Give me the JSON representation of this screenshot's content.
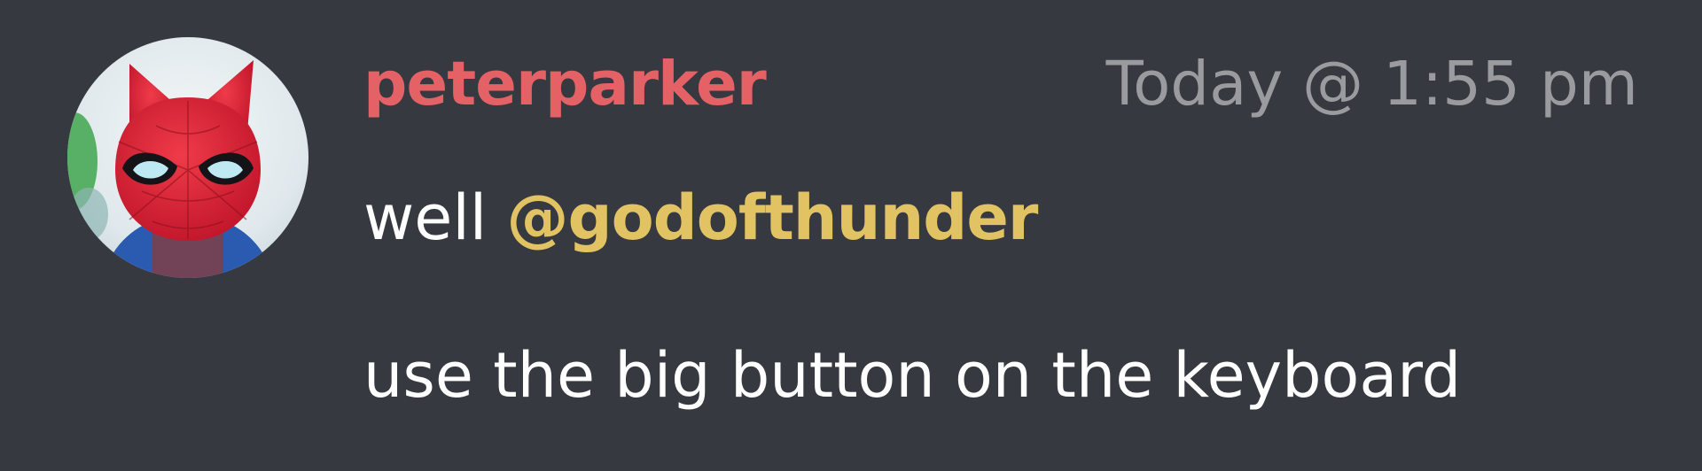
{
  "message": {
    "author": "peterparker",
    "timestamp": "Today @ 1:55 pm",
    "line1_prefix": "well ",
    "mention": "@godofthunder",
    "line2": "use the big button on the keyboard",
    "avatar_icon": "spider-cat-avatar-icon"
  },
  "colors": {
    "background": "#373940",
    "author": "#e46266",
    "timestamp": "#9a9b9e",
    "text": "#ffffff",
    "mention": "#e2c363"
  }
}
